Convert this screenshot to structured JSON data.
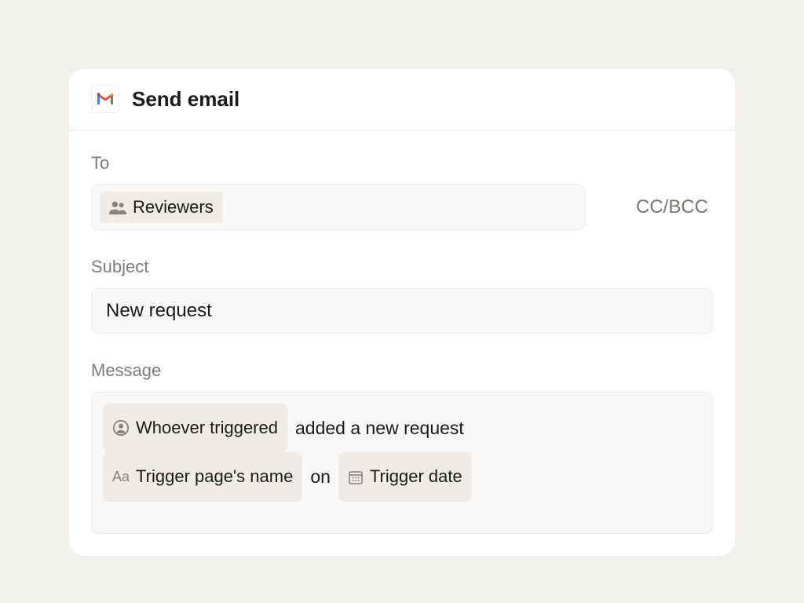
{
  "header": {
    "title": "Send email"
  },
  "to": {
    "label": "To",
    "chip_label": "Reviewers",
    "cc_bcc_label": "CC/BCC"
  },
  "subject": {
    "label": "Subject",
    "value": "New request"
  },
  "message": {
    "label": "Message",
    "token_whoever": "Whoever triggered",
    "text_added": "added a new request",
    "token_page_name": "Trigger page's name",
    "text_on": "on",
    "token_trigger_date": "Trigger date"
  }
}
